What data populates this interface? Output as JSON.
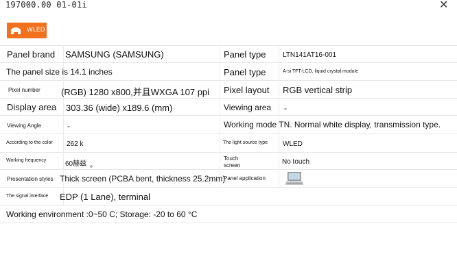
{
  "window": {
    "title": "197000.00 01-01i",
    "close_glyph": "✕"
  },
  "logo": {
    "text": "WLED",
    "color": "#f2701e"
  },
  "rows": {
    "r1": {
      "l1": "Panel brand",
      "v1": "SAMSUNG (SAMSUNG)",
      "l2": "Panel type",
      "v2": "LTN141AT16-001"
    },
    "r2": {
      "l1": "The panel size is 14.1 inches",
      "l2": "Panel type",
      "v2": "A-si TFT-LCD, liquid crystal module"
    },
    "r3": {
      "l1": "Pixel number",
      "v1": "(RGB) 1280 x800,并且WXGA 107 ppi",
      "l2": "Pixel layout",
      "v2": "RGB vertical strip"
    },
    "r4": {
      "l1": "Display area",
      "v1": "303.36 (wide) x189.6 (mm)",
      "l2": "Viewing area",
      "v2": "-"
    },
    "r5": {
      "l1": "Viewing Angle",
      "v1": "-",
      "l2": "Working mode TN. Normal white display, transmission type."
    },
    "r6": {
      "l1": "According to the color",
      "v1": "262 k",
      "l2": "The light source type",
      "v2": "WLED"
    },
    "r7": {
      "l1": "Working frequency",
      "v1": "60赫兹",
      "v1b": "。",
      "l2a": "Touch",
      "l2b": "screen",
      "v2": "No touch"
    },
    "r8": {
      "l1": "Presentation styles",
      "v1": "Thick screen (PCBA bent, thickness 25.2mm)",
      "l2": "Panel application",
      "icon": "laptop-icon"
    },
    "r9": {
      "l1": "The signal interface",
      "v1": "EDP (1 Lane), terminal"
    },
    "r10": {
      "l1": "Working environment :0~50 C; Storage: -20 to 60 °C"
    }
  }
}
